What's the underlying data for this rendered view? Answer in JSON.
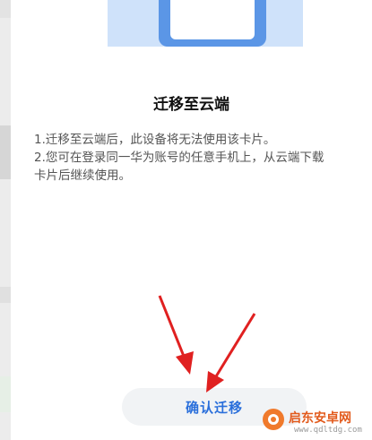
{
  "dialog": {
    "title": "迁移至云端",
    "description": [
      "1.迁移至云端后，此设备将无法使用该卡片。",
      "2.您可在登录同一华为账号的任意手机上，从云端下载",
      "卡片后继续使用。"
    ],
    "confirm_label": "确认迁移"
  },
  "watermark": {
    "title": "启东安卓网",
    "url": "www.qdltdg.com"
  },
  "colors": {
    "accent": "#2a6fdb",
    "annotation": "#e02020",
    "hero_blue": "#5b96e6"
  }
}
